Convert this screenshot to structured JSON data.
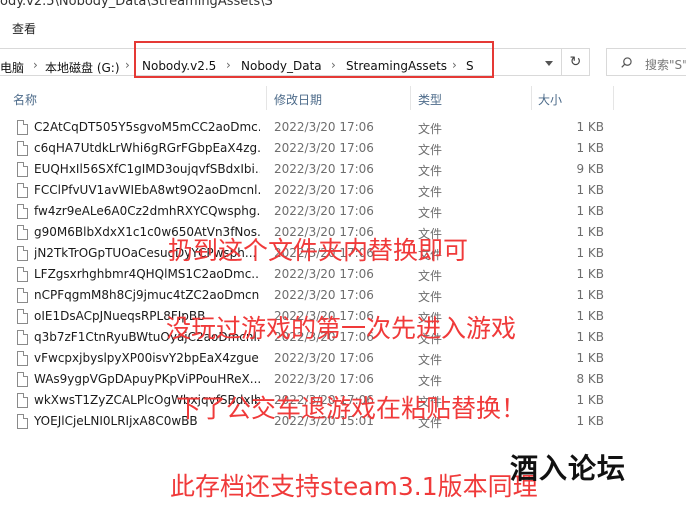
{
  "window": {
    "path_title": "ody.v2.5\\Nobody_Data\\StreamingAssets\\S"
  },
  "menu": {
    "view": "查看"
  },
  "address": {
    "root_partial": "电脑",
    "crumbs": [
      "本地磁盘 (G:)",
      "Nobody.v2.5",
      "Nobody_Data",
      "StreamingAssets",
      "S"
    ],
    "refresh_icon": "refresh-icon"
  },
  "search": {
    "placeholder": "搜索\"S\""
  },
  "columns": {
    "name": "名称",
    "modified": "修改日期",
    "type": "类型",
    "size": "大小"
  },
  "files": [
    {
      "name": "C2AtCqDT505Y5sgvoM5mCC2aoDmc...",
      "date": "2022/3/20 17:06",
      "type": "文件",
      "size": "1 KB"
    },
    {
      "name": "c6qHA7UtdkLrWhi6gRGrFGbpEaX4zg...",
      "date": "2022/3/20 17:06",
      "type": "文件",
      "size": "1 KB"
    },
    {
      "name": "EUQHxIl56SXfC1gIMD3oujqvfSBdxIbi...",
      "date": "2022/3/20 17:06",
      "type": "文件",
      "size": "9 KB"
    },
    {
      "name": "FCClPfvUV1avWIEbA8wt9O2aoDmcnl...",
      "date": "2022/3/20 17:06",
      "type": "文件",
      "size": "1 KB"
    },
    {
      "name": "fw4zr9eALe6A0Cz2dmhRXYCQwsphg...",
      "date": "2022/3/20 17:06",
      "type": "文件",
      "size": "1 KB"
    },
    {
      "name": "g90M6BlbXdxX1c1c0w650AtVn3fNos...",
      "date": "2022/3/20 17:06",
      "type": "文件",
      "size": "1 KB"
    },
    {
      "name": "jN2TkTrOGpTUOaCesuoDyYCPwsph...",
      "date": "2022/3/20 17:06",
      "type": "文件",
      "size": "1 KB"
    },
    {
      "name": "LFZgsxrhghbmr4QHQlMS1C2aoDmc...",
      "date": "2022/3/20 17:06",
      "type": "文件",
      "size": "1 KB"
    },
    {
      "name": "nCPFqgmM8h8Cj9jmuc4tZC2aoDmcnl...",
      "date": "2022/3/20 17:06",
      "type": "文件",
      "size": "1 KB"
    },
    {
      "name": "oIE1DsACpJNueqsRPL8FIpBB",
      "date": "2022/3/20 17:06",
      "type": "文件",
      "size": "1 KB"
    },
    {
      "name": "q3b7zF1CtnRyuBWtuOyajC2aoDmcnl...",
      "date": "2022/3/20 17:06",
      "type": "文件",
      "size": "1 KB"
    },
    {
      "name": "vFwcpxjbyslpyXP00isvY2bpEaX4zgue...",
      "date": "2022/3/20 17:06",
      "type": "文件",
      "size": "1 KB"
    },
    {
      "name": "WAs9ygpVGpDApuyPKpViPPouHReX...",
      "date": "2022/3/20 17:06",
      "type": "文件",
      "size": "8 KB"
    },
    {
      "name": "wkXwsT1ZyZCALPlcOgWbxjqvfSBdxIb...",
      "date": "2022/3/20 17:06",
      "type": "文件",
      "size": "1 KB"
    },
    {
      "name": "YOEJlCjeLNI0LRIjxA8C0wBB",
      "date": "2022/3/20 15:01",
      "type": "文件",
      "size": "1 KB"
    }
  ],
  "overlay_text": {
    "line1": "扔到这个文件夹内替换即可",
    "line2": "没玩过游戏的第一次先进入游戏",
    "line3": "下了公交车退游戏在粘贴替换！",
    "line4": "此存档还支持steam3.1版本同理"
  },
  "watermark": {
    "logo": "酒入论坛"
  },
  "colors": {
    "highlight_border": "#e53935",
    "overlay_text": "#f03a3a",
    "header_text": "#4d6b8a"
  }
}
